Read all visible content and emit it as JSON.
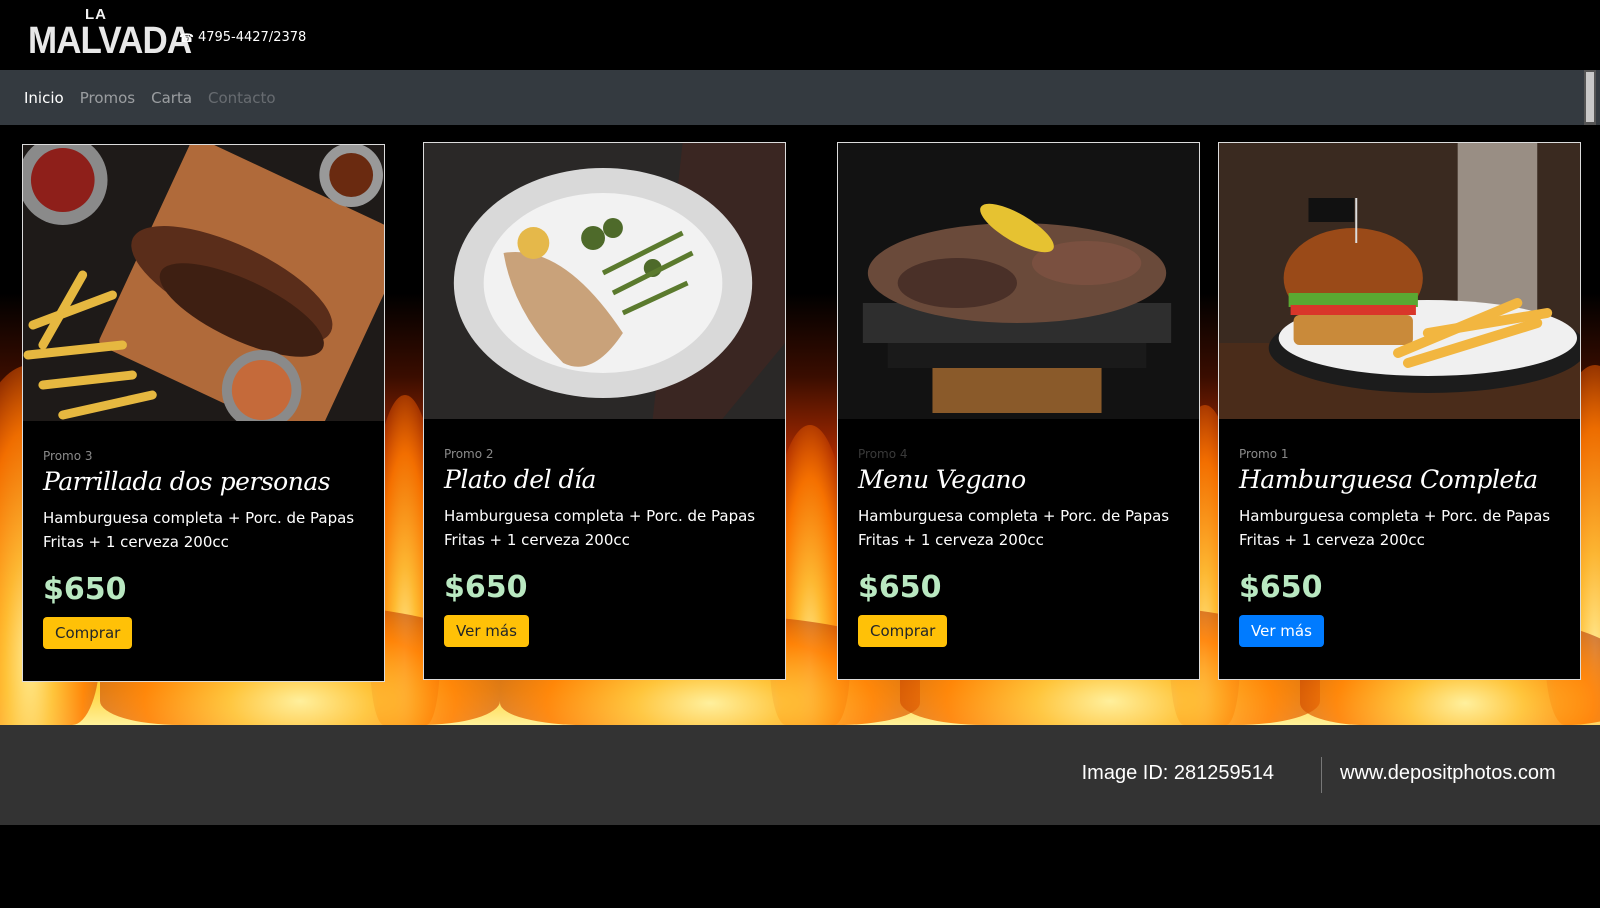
{
  "brand": {
    "logo_top": "LA",
    "logo_main": "MALVADA",
    "phone": "4795-4427/2378"
  },
  "nav": {
    "items": [
      {
        "label": "Inicio",
        "state": "active"
      },
      {
        "label": "Promos",
        "state": "normal"
      },
      {
        "label": "Carta",
        "state": "normal"
      },
      {
        "label": "Contacto",
        "state": "disabled"
      }
    ]
  },
  "cards": [
    {
      "subtitle": "Promo 3",
      "title": "Parrillada dos personas",
      "description": "Hamburguesa completa + Porc. de Papas Fritas + 1 cerveza 200cc",
      "price": "$650",
      "button": "Comprar",
      "button_style": "warning",
      "image": "parrillada-ribs-fries-photo"
    },
    {
      "subtitle": "Promo 2",
      "title": "Plato del día",
      "description": "Hamburguesa completa + Porc. de Papas Fritas + 1 cerveza 200cc",
      "price": "$650",
      "button": "Ver más",
      "button_style": "warning",
      "image": "fish-plate-vegetables-photo"
    },
    {
      "subtitle": "Promo 4",
      "title": "Menu Vegano",
      "description": "Hamburguesa completa + Porc. de Papas Fritas + 1 cerveza 200cc",
      "price": "$650",
      "button": "Comprar",
      "button_style": "warning",
      "image": "grill-corn-meat-photo"
    },
    {
      "subtitle": "Promo 1",
      "title": "Hamburguesa Completa",
      "description": "Hamburguesa completa + Porc. de Papas Fritas + 1 cerveza 200cc",
      "price": "$650",
      "button": "Ver más",
      "button_style": "primary",
      "image": "burger-fries-photo"
    }
  ],
  "watermark": {
    "image_id": "Image ID: 281259514",
    "site": "www.depositphotos.com"
  },
  "colors": {
    "price": "#b9e8c1",
    "warning": "#ffc107",
    "primary": "#007bff",
    "navbar": "#343a40"
  }
}
